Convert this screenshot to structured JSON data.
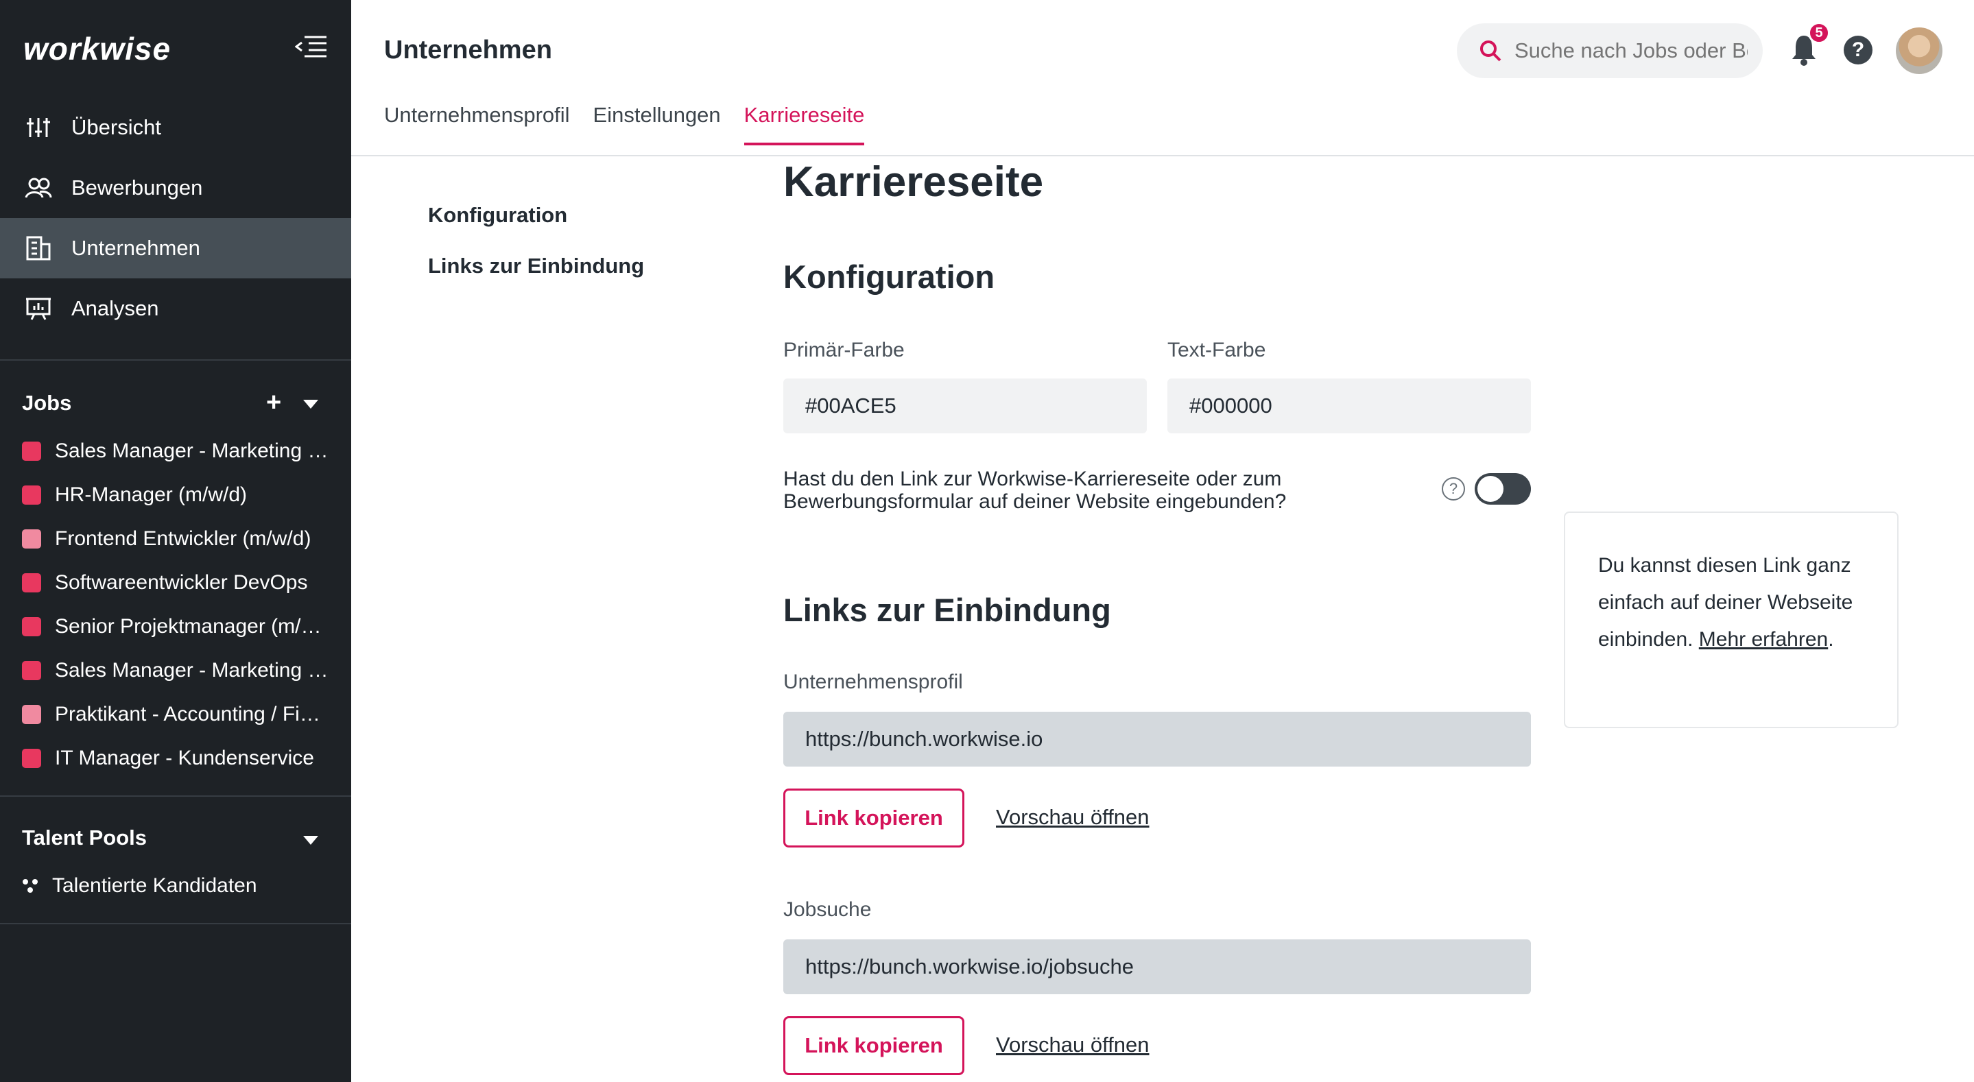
{
  "sidebar": {
    "logo": "workwise",
    "nav": [
      {
        "label": "Übersicht",
        "icon": "sliders-icon"
      },
      {
        "label": "Bewerbungen",
        "icon": "people-icon"
      },
      {
        "label": "Unternehmen",
        "icon": "building-icon",
        "active": true
      },
      {
        "label": "Analysen",
        "icon": "presentation-chart-icon"
      }
    ],
    "jobs_title": "Jobs",
    "add_symbol": "+",
    "jobs": [
      {
        "label": "Sales Manager - Marketing / Vertrieb",
        "color": "#e8385f"
      },
      {
        "label": "HR-Manager (m/w/d)",
        "color": "#e8385f"
      },
      {
        "label": "Frontend Entwickler (m/w/d)",
        "color": "#f08aa0"
      },
      {
        "label": "Softwareentwickler DevOps",
        "color": "#e8385f"
      },
      {
        "label": "Senior Projektmanager (m/w/d)",
        "color": "#e8385f"
      },
      {
        "label": "Sales Manager - Marketing / Vertrieb",
        "color": "#e8385f"
      },
      {
        "label": "Praktikant - Accounting / Finance",
        "color": "#f08aa0"
      },
      {
        "label": "IT Manager - Kundenservice",
        "color": "#e8385f"
      }
    ],
    "talent_title": "Talent Pools",
    "talent_item": "Talentierte Kandidaten"
  },
  "header": {
    "title": "Unternehmen",
    "search_placeholder": "Suche nach Jobs oder Bewerbern",
    "notification_count": "5",
    "help_symbol": "?"
  },
  "tabs": [
    "Unternehmensprofil",
    "Einstellungen",
    "Karriereseite"
  ],
  "subnav": [
    "Konfiguration",
    "Links zur Einbindung"
  ],
  "main": {
    "title": "Karriereseite",
    "config_title": "Konfiguration",
    "primary_label": "Primär-Farbe",
    "primary_value": "#00ACE5",
    "text_label": "Text-Farbe",
    "text_value": "#000000",
    "question": "Hast du den Link zur Workwise-Karriereseite oder zum Bewerbungsformular auf deiner Website eingebunden?",
    "question_help": "?",
    "links_title": "Links zur Einbindung",
    "profile_label": "Unternehmensprofil",
    "profile_url": "https://bunch.workwise.io",
    "jobsuche_label": "Jobsuche",
    "jobsuche_url": "https://bunch.workwise.io/jobsuche",
    "copy_label": "Link kopieren",
    "preview_label": "Vorschau öffnen"
  },
  "info": {
    "text": "Du kannst diesen Link ganz einfach auf deiner Webseite einbinden. ",
    "link": "Mehr erfahren",
    "end": "."
  },
  "colors": {
    "accent": "#d4145a",
    "sidebar": "#1e2226"
  }
}
